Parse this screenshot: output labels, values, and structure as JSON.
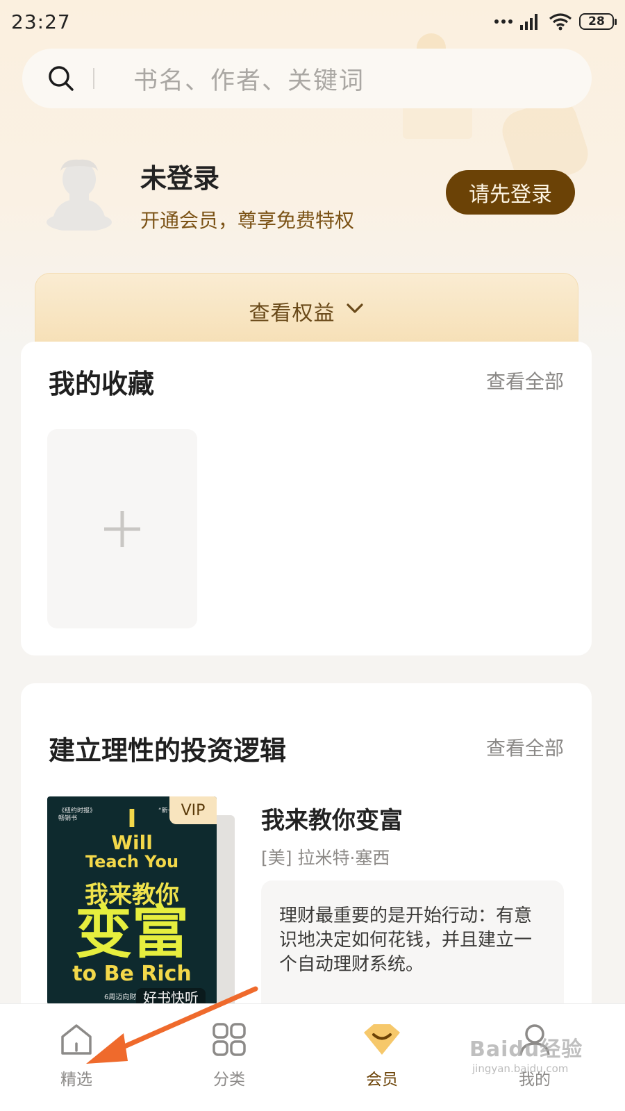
{
  "status_bar": {
    "time": "23:27",
    "battery": "28"
  },
  "search": {
    "placeholder": "书名、作者、关键词",
    "icon": "search-icon"
  },
  "profile": {
    "name": "未登录",
    "subtitle": "开通会员，尊享免费特权",
    "login_button": "请先登录"
  },
  "benefits": {
    "label": "查看权益"
  },
  "favorites": {
    "title": "我的收藏",
    "more": "查看全部"
  },
  "invest_section": {
    "title": "建立理性的投资逻辑",
    "more": "查看全部",
    "book": {
      "vip_badge": "VIP",
      "title": "我来教你变富",
      "author": "[美] 拉米特·塞西",
      "description": "理财最重要的是开始行动：有意识地决定如何花钱，并且建立一个自动理财系统。",
      "cover": {
        "line1": "I",
        "line2": "Will",
        "line3": "Teach You",
        "cn_line": "我来教你",
        "cn_big": "变富",
        "line4": "to Be Rich",
        "footer": "好书快听",
        "footer_small": "6周迈向财",
        "tag_left": "《纽约时报》\n畅销书",
        "tag_right": "“新一"
      }
    }
  },
  "tab_bar": {
    "tabs": [
      {
        "label": "精选",
        "icon": "home-icon",
        "active": false
      },
      {
        "label": "分类",
        "icon": "grid-icon",
        "active": false
      },
      {
        "label": "会员",
        "icon": "vip-icon",
        "active": true
      },
      {
        "label": "我的",
        "icon": "profile-icon",
        "active": false
      }
    ]
  },
  "watermark": {
    "text": "Baidu经验",
    "sub": "jingyan.baidu.com"
  },
  "colors": {
    "accent_brown": "#6b4206",
    "gold_light": "#f6dfb5",
    "annotation_orange": "#ef6a2c"
  }
}
